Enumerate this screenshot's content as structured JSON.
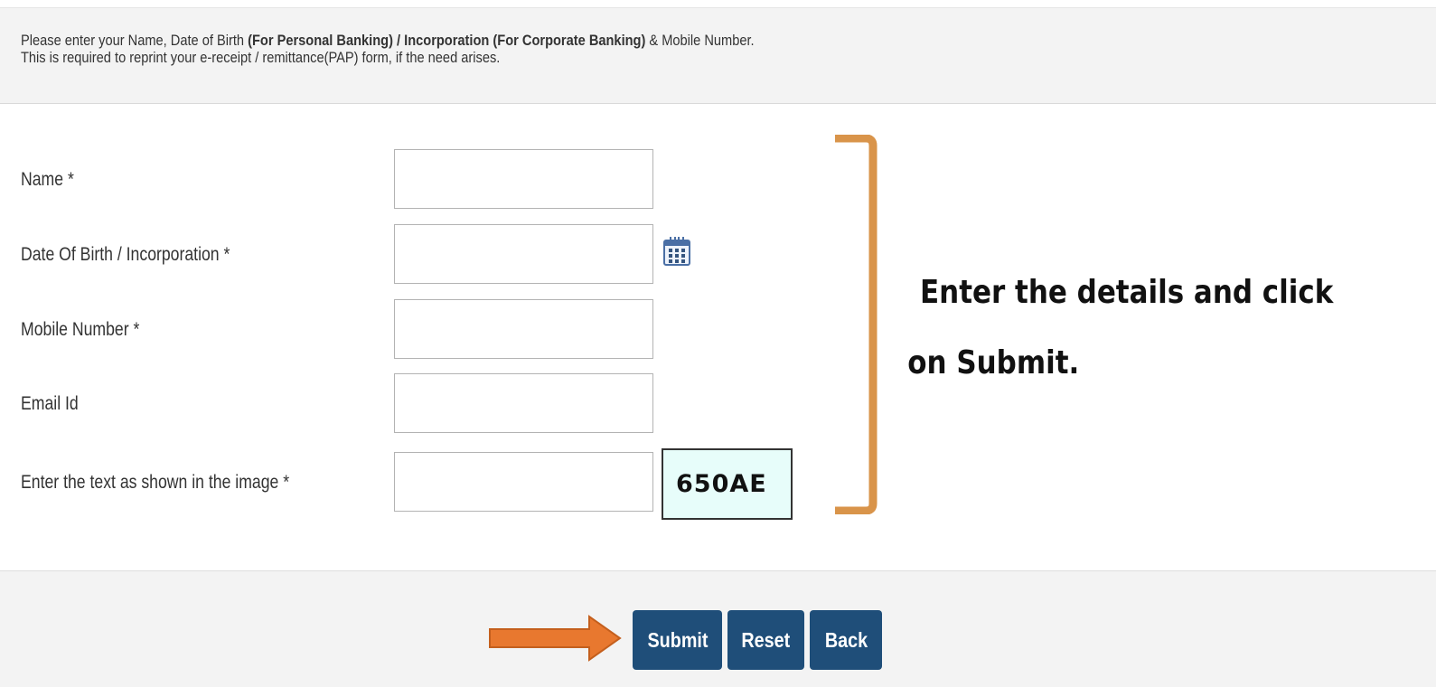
{
  "notice": {
    "line1_prefix": "Please enter your Name, Date of Birth ",
    "line1_bold1": "(For Personal Banking) / Incorporation (For Corporate Banking)",
    "line1_suffix": "  & Mobile Number.",
    "line2": "This is required to reprint your e-receipt / remittance(PAP) form, if the need arises."
  },
  "form": {
    "name_label": "Name *",
    "name_value": "",
    "dob_label": "Date Of Birth / Incorporation *",
    "dob_value": "",
    "mobile_label": "Mobile Number *",
    "mobile_value": "",
    "email_label": "Email Id",
    "email_value": "",
    "captcha_label": "Enter the text as shown in the image *",
    "captcha_value": "",
    "captcha_text": "650AE",
    "calendar_icon": "calendar-icon"
  },
  "annotation": {
    "line1": "Enter the details and click",
    "line2": "on Submit.",
    "bracket_color": "#d9944a",
    "arrow_color": "#e8782f"
  },
  "buttons": {
    "submit": "Submit",
    "reset": "Reset",
    "back": "Back",
    "color": "#1f4e79"
  }
}
